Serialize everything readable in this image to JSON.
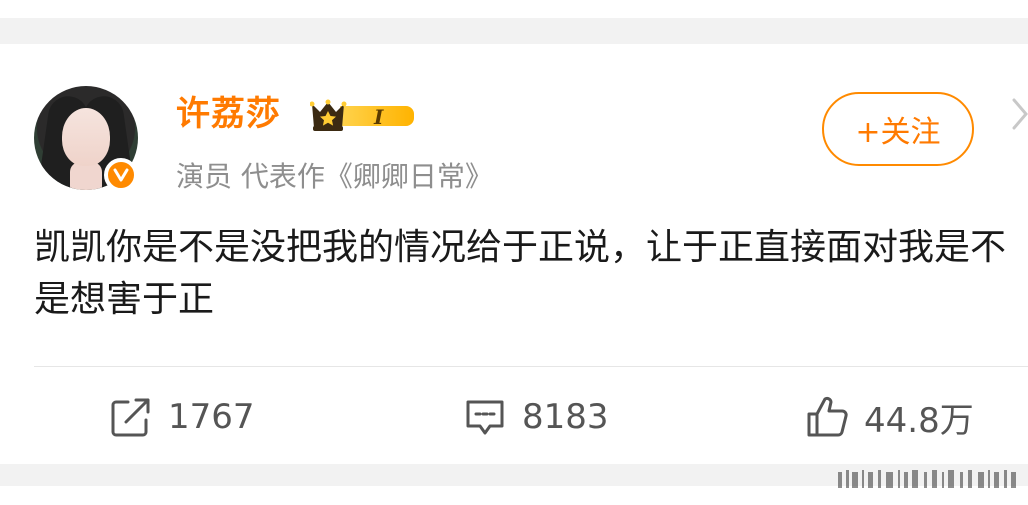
{
  "post": {
    "author": {
      "name": "许荔莎",
      "vip_level": "I",
      "description": "演员 代表作《卿卿日常》"
    },
    "follow_label": "+关注",
    "content": "凯凯你是不是没把我的情况给于正说，让于正直接面对我是不是想害于正",
    "actions": {
      "repost_count": "1767",
      "comment_count": "8183",
      "like_count": "44.8万"
    }
  },
  "colors": {
    "accent": "#ff7a00",
    "muted": "#8e8e8e",
    "text": "#1a1a1a"
  },
  "icons": [
    "verified-badge-icon",
    "vip-crown-icon",
    "chevron-right-icon",
    "repost-icon",
    "comment-icon",
    "like-icon"
  ]
}
